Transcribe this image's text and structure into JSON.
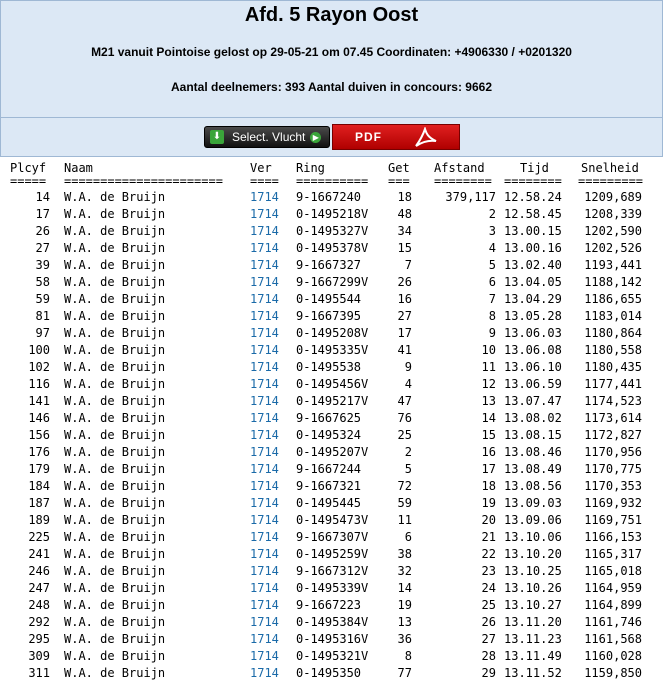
{
  "header": {
    "title": "Afd. 5 Rayon Oost",
    "info_line": "M21 vanuit Pointoise gelost op 29-05-21 om 07.45 Coordinaten: +4906330 / +0201320",
    "counts_line": "Aantal deelnemers: 393 Aantal duiven in concours: 9662"
  },
  "toolbar": {
    "select_label": "Select. Vlucht",
    "pdf_label": "PDF"
  },
  "table": {
    "columns": [
      "Plcyf",
      "Naam",
      "Ver",
      "Ring",
      "Get",
      "Afstand",
      "Tijd",
      "Snelheid"
    ],
    "separators": [
      "=====",
      "======================",
      "====",
      "==========",
      "===",
      "========",
      "========",
      "========="
    ],
    "rows": [
      {
        "plcyf": "14",
        "naam": "W.A. de Bruijn",
        "ver": "1714",
        "ring": "9-1667240",
        "get": "18",
        "afstand": "379,117",
        "tijd": "12.58.24",
        "snelheid": "1209,689"
      },
      {
        "plcyf": "17",
        "naam": "W.A. de Bruijn",
        "ver": "1714",
        "ring": "0-1495218V",
        "get": "48",
        "afstand": "2",
        "tijd": "12.58.45",
        "snelheid": "1208,339"
      },
      {
        "plcyf": "26",
        "naam": "W.A. de Bruijn",
        "ver": "1714",
        "ring": "0-1495327V",
        "get": "34",
        "afstand": "3",
        "tijd": "13.00.15",
        "snelheid": "1202,590"
      },
      {
        "plcyf": "27",
        "naam": "W.A. de Bruijn",
        "ver": "1714",
        "ring": "0-1495378V",
        "get": "15",
        "afstand": "4",
        "tijd": "13.00.16",
        "snelheid": "1202,526"
      },
      {
        "plcyf": "39",
        "naam": "W.A. de Bruijn",
        "ver": "1714",
        "ring": "9-1667327",
        "get": "7",
        "afstand": "5",
        "tijd": "13.02.40",
        "snelheid": "1193,441"
      },
      {
        "plcyf": "58",
        "naam": "W.A. de Bruijn",
        "ver": "1714",
        "ring": "9-1667299V",
        "get": "26",
        "afstand": "6",
        "tijd": "13.04.05",
        "snelheid": "1188,142"
      },
      {
        "plcyf": "59",
        "naam": "W.A. de Bruijn",
        "ver": "1714",
        "ring": "0-1495544",
        "get": "16",
        "afstand": "7",
        "tijd": "13.04.29",
        "snelheid": "1186,655"
      },
      {
        "plcyf": "81",
        "naam": "W.A. de Bruijn",
        "ver": "1714",
        "ring": "9-1667395",
        "get": "27",
        "afstand": "8",
        "tijd": "13.05.28",
        "snelheid": "1183,014"
      },
      {
        "plcyf": "97",
        "naam": "W.A. de Bruijn",
        "ver": "1714",
        "ring": "0-1495208V",
        "get": "17",
        "afstand": "9",
        "tijd": "13.06.03",
        "snelheid": "1180,864"
      },
      {
        "plcyf": "100",
        "naam": "W.A. de Bruijn",
        "ver": "1714",
        "ring": "0-1495335V",
        "get": "41",
        "afstand": "10",
        "tijd": "13.06.08",
        "snelheid": "1180,558"
      },
      {
        "plcyf": "102",
        "naam": "W.A. de Bruijn",
        "ver": "1714",
        "ring": "0-1495538",
        "get": "9",
        "afstand": "11",
        "tijd": "13.06.10",
        "snelheid": "1180,435"
      },
      {
        "plcyf": "116",
        "naam": "W.A. de Bruijn",
        "ver": "1714",
        "ring": "0-1495456V",
        "get": "4",
        "afstand": "12",
        "tijd": "13.06.59",
        "snelheid": "1177,441"
      },
      {
        "plcyf": "141",
        "naam": "W.A. de Bruijn",
        "ver": "1714",
        "ring": "0-1495217V",
        "get": "47",
        "afstand": "13",
        "tijd": "13.07.47",
        "snelheid": "1174,523"
      },
      {
        "plcyf": "146",
        "naam": "W.A. de Bruijn",
        "ver": "1714",
        "ring": "9-1667625",
        "get": "76",
        "afstand": "14",
        "tijd": "13.08.02",
        "snelheid": "1173,614"
      },
      {
        "plcyf": "156",
        "naam": "W.A. de Bruijn",
        "ver": "1714",
        "ring": "0-1495324",
        "get": "25",
        "afstand": "15",
        "tijd": "13.08.15",
        "snelheid": "1172,827"
      },
      {
        "plcyf": "176",
        "naam": "W.A. de Bruijn",
        "ver": "1714",
        "ring": "0-1495207V",
        "get": "2",
        "afstand": "16",
        "tijd": "13.08.46",
        "snelheid": "1170,956"
      },
      {
        "plcyf": "179",
        "naam": "W.A. de Bruijn",
        "ver": "1714",
        "ring": "9-1667244",
        "get": "5",
        "afstand": "17",
        "tijd": "13.08.49",
        "snelheid": "1170,775"
      },
      {
        "plcyf": "184",
        "naam": "W.A. de Bruijn",
        "ver": "1714",
        "ring": "9-1667321",
        "get": "72",
        "afstand": "18",
        "tijd": "13.08.56",
        "snelheid": "1170,353"
      },
      {
        "plcyf": "187",
        "naam": "W.A. de Bruijn",
        "ver": "1714",
        "ring": "0-1495445",
        "get": "59",
        "afstand": "19",
        "tijd": "13.09.03",
        "snelheid": "1169,932"
      },
      {
        "plcyf": "189",
        "naam": "W.A. de Bruijn",
        "ver": "1714",
        "ring": "0-1495473V",
        "get": "11",
        "afstand": "20",
        "tijd": "13.09.06",
        "snelheid": "1169,751"
      },
      {
        "plcyf": "225",
        "naam": "W.A. de Bruijn",
        "ver": "1714",
        "ring": "9-1667307V",
        "get": "6",
        "afstand": "21",
        "tijd": "13.10.06",
        "snelheid": "1166,153"
      },
      {
        "plcyf": "241",
        "naam": "W.A. de Bruijn",
        "ver": "1714",
        "ring": "0-1495259V",
        "get": "38",
        "afstand": "22",
        "tijd": "13.10.20",
        "snelheid": "1165,317"
      },
      {
        "plcyf": "246",
        "naam": "W.A. de Bruijn",
        "ver": "1714",
        "ring": "9-1667312V",
        "get": "32",
        "afstand": "23",
        "tijd": "13.10.25",
        "snelheid": "1165,018"
      },
      {
        "plcyf": "247",
        "naam": "W.A. de Bruijn",
        "ver": "1714",
        "ring": "0-1495339V",
        "get": "14",
        "afstand": "24",
        "tijd": "13.10.26",
        "snelheid": "1164,959"
      },
      {
        "plcyf": "248",
        "naam": "W.A. de Bruijn",
        "ver": "1714",
        "ring": "9-1667223",
        "get": "19",
        "afstand": "25",
        "tijd": "13.10.27",
        "snelheid": "1164,899"
      },
      {
        "plcyf": "292",
        "naam": "W.A. de Bruijn",
        "ver": "1714",
        "ring": "0-1495384V",
        "get": "13",
        "afstand": "26",
        "tijd": "13.11.20",
        "snelheid": "1161,746"
      },
      {
        "plcyf": "295",
        "naam": "W.A. de Bruijn",
        "ver": "1714",
        "ring": "0-1495316V",
        "get": "36",
        "afstand": "27",
        "tijd": "13.11.23",
        "snelheid": "1161,568"
      },
      {
        "plcyf": "309",
        "naam": "W.A. de Bruijn",
        "ver": "1714",
        "ring": "0-1495321V",
        "get": "8",
        "afstand": "28",
        "tijd": "13.11.49",
        "snelheid": "1160,028"
      },
      {
        "plcyf": "311",
        "naam": "W.A. de Bruijn",
        "ver": "1714",
        "ring": "0-1495350",
        "get": "77",
        "afstand": "29",
        "tijd": "13.11.52",
        "snelheid": "1159,850"
      }
    ]
  },
  "colors": {
    "header_bg": "#dce8f5",
    "header_border": "#9fb8d4",
    "ver_link": "#1a6aa8",
    "pdf_red": "#cc0000"
  },
  "icons": {
    "select_download": "download-icon",
    "select_arrow": "arrow-right-icon",
    "pdf_logo": "acrobat-icon"
  }
}
